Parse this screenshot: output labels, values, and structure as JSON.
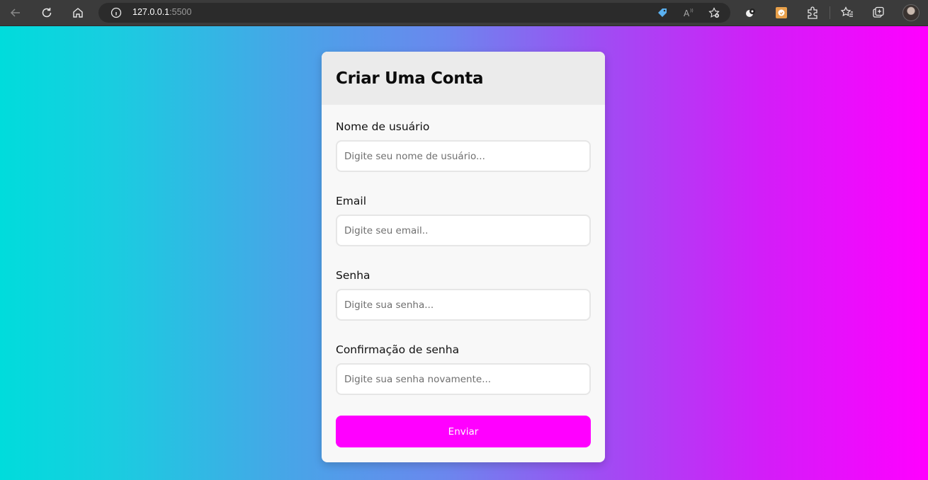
{
  "browser": {
    "url_host": "127.0.0.1",
    "url_port": ":5500",
    "icons": [
      "back-icon",
      "reload-icon",
      "home-icon",
      "info-icon",
      "tag-icon",
      "read-aloud-icon",
      "add-favorite-icon",
      "extension-a-icon",
      "extension-b-icon",
      "extensions-icon",
      "favorites-icon",
      "collections-icon",
      "profile-avatar"
    ]
  },
  "colors": {
    "gradient_start": "#00dcdc",
    "gradient_end": "#ff00ff",
    "button": "#ff00ff"
  },
  "form": {
    "title": "Criar Uma Conta",
    "fields": [
      {
        "label": "Nome de usuário",
        "placeholder": "Digite seu nome de usuário..."
      },
      {
        "label": "Email",
        "placeholder": "Digite seu email.."
      },
      {
        "label": "Senha",
        "placeholder": "Digite sua senha..."
      },
      {
        "label": "Confirmação de senha",
        "placeholder": "Digite sua senha novamente..."
      }
    ],
    "submit_label": "Enviar"
  }
}
